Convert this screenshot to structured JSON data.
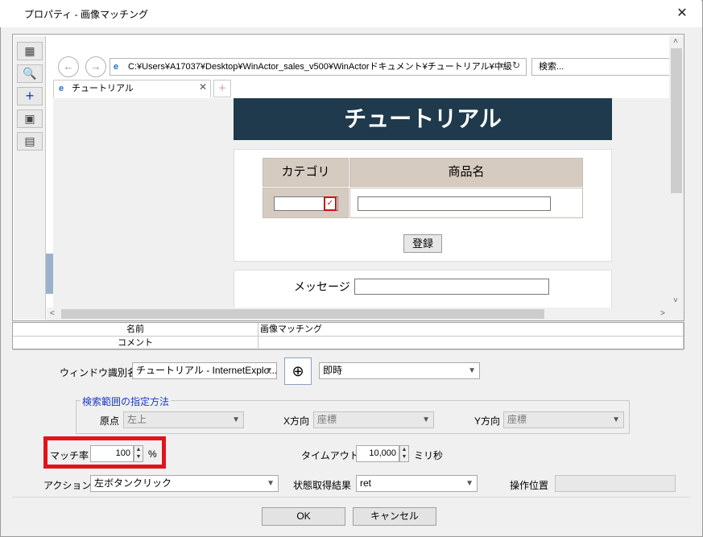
{
  "window": {
    "title": "プロパティ - 画像マッチング",
    "close_glyph": "✕"
  },
  "toolbar": {
    "tools": [
      "select-area-icon",
      "zoom-search-icon",
      "crosshair-icon",
      "capture-icon",
      "capture-window-icon"
    ]
  },
  "browser": {
    "back": "←",
    "forward": "→",
    "address": "C:¥Users¥A17037¥Desktop¥WinActor_sales_v500¥WinActorドキュメント¥チュートリアル¥中級",
    "address_dropdown": "▾",
    "refresh": "↻",
    "search_placeholder": "検索...",
    "tab_label": "チュートリアル",
    "tab_close": "✕",
    "new_tab": "＋"
  },
  "page": {
    "banner": "チュートリアル",
    "col_category": "カテゴリ",
    "col_product": "商品名",
    "select_mark": "✓",
    "register_button": "登録",
    "message_label": "メッセージ"
  },
  "scroll": {
    "up": "˄",
    "down": "˅",
    "left": "<",
    "right": ">"
  },
  "grid": {
    "rows": [
      {
        "key": "名前",
        "value": "画像マッチング"
      },
      {
        "key": "コメント",
        "value": ""
      }
    ]
  },
  "form": {
    "window_id_label": "ウィンドウ識別名",
    "window_id_value": "チュートリアル - InternetExplo...",
    "timing_value": "即時",
    "group_title": "検索範囲の指定方法",
    "origin_label": "原点",
    "origin_value": "左上",
    "xdir_label": "X方向",
    "xdir_value": "座標",
    "ydir_label": "Y方向",
    "ydir_value": "座標",
    "match_label": "マッチ率",
    "match_value": "100",
    "match_unit": "%",
    "timeout_label": "タイムアウト",
    "timeout_value": "10,000",
    "timeout_unit": "ミリ秒",
    "action_label": "アクション",
    "action_value": "左ボタンクリック",
    "status_label": "状態取得結果",
    "status_value": "ret",
    "oppos_label": "操作位置",
    "oppos_value": ""
  },
  "buttons": {
    "ok": "OK",
    "cancel": "キャンセル"
  },
  "colors": {
    "highlight": "#e2131a",
    "banner_bg": "#1e3a4c",
    "header_bg": "#d6cbc1",
    "group_title": "#1a3cc0"
  }
}
